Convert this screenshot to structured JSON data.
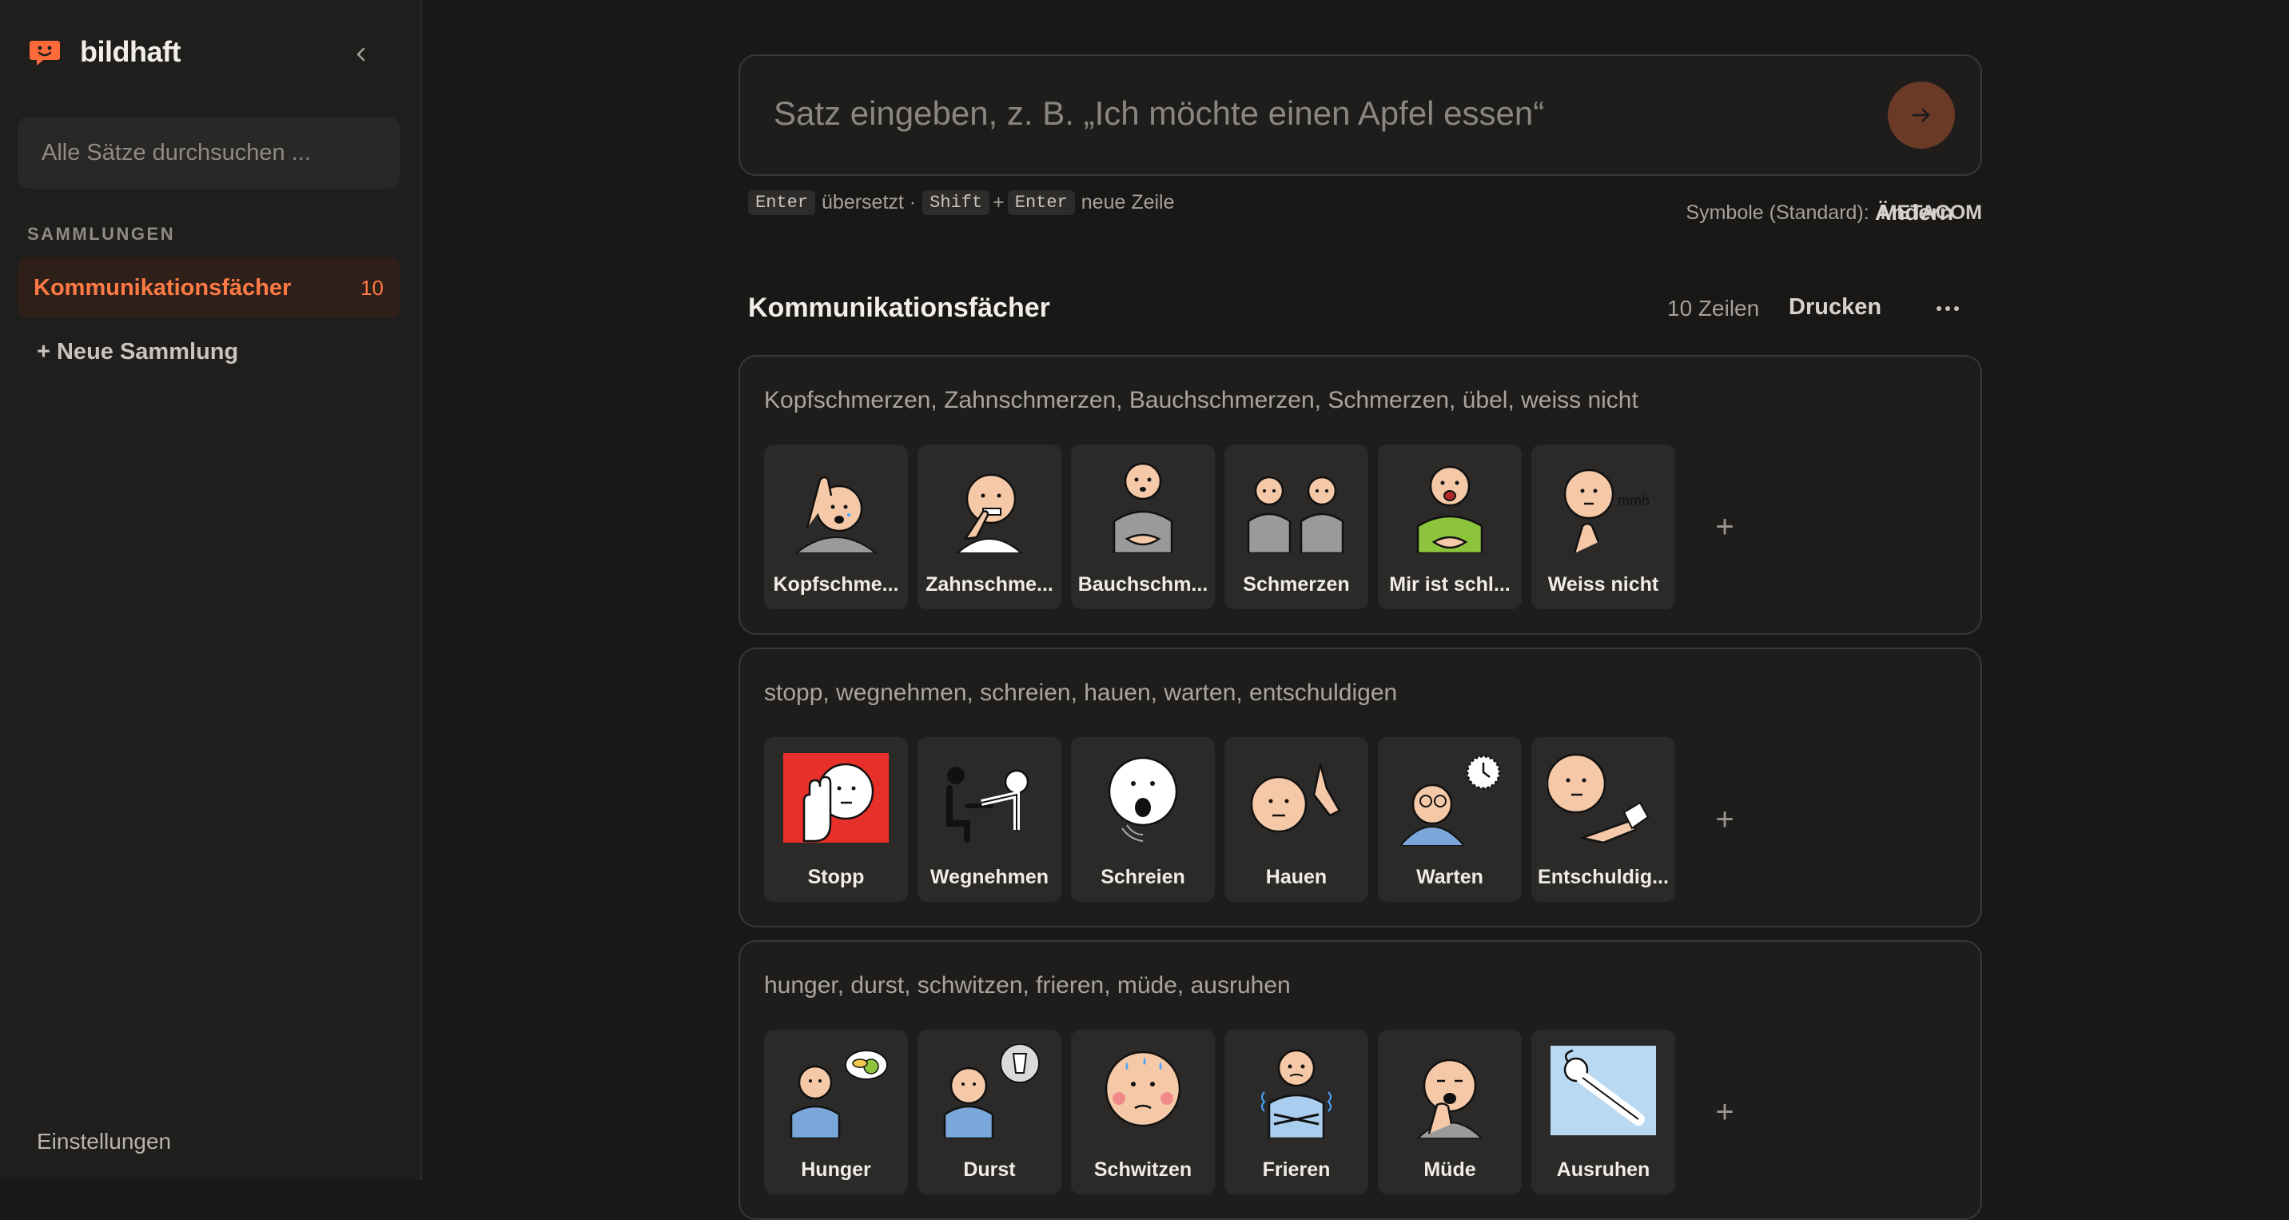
{
  "sidebar": {
    "app_name": "bildhaft",
    "search_placeholder": "Alle Sätze durchsuchen ...",
    "section_label": "SAMMLUNGEN",
    "collections": [
      {
        "name": "Kommunikationsfächer",
        "count": "10"
      }
    ],
    "new_collection_label": "+ Neue Sammlung",
    "settings_label": "Einstellungen"
  },
  "composer": {
    "placeholder": "Satz eingeben, z. B. „Ich möchte einen Apfel essen“",
    "hint_enter_key": "Enter",
    "hint_translate": "übersetzt ·",
    "hint_shift_key": "Shift",
    "hint_plus": "+",
    "hint_enter_key2": "Enter",
    "hint_newline": "neue Zeile",
    "symbols_label": "Symbole (Standard):",
    "symbols_value": "METACOM",
    "change_label": "Ändern"
  },
  "list": {
    "title": "Kommunikationsfächer",
    "row_count": "10 Zeilen",
    "print_label": "Drucken",
    "rows": [
      {
        "sentence": "Kopfschmerzen, Zahnschmerzen, Bauchschmerzen, Schmerzen, übel, weiss nicht",
        "symbols": [
          {
            "label": "Kopfschme...",
            "icon": "headache-icon"
          },
          {
            "label": "Zahnschme...",
            "icon": "toothache-icon"
          },
          {
            "label": "Bauchschm...",
            "icon": "stomachache-icon"
          },
          {
            "label": "Schmerzen",
            "icon": "pain-icon"
          },
          {
            "label": "Mir ist schl...",
            "icon": "nausea-icon"
          },
          {
            "label": "Weiss nicht",
            "icon": "dont-know-icon"
          }
        ]
      },
      {
        "sentence": "stopp, wegnehmen, schreien, hauen, warten, entschuldigen",
        "symbols": [
          {
            "label": "Stopp",
            "icon": "stop-icon"
          },
          {
            "label": "Wegnehmen",
            "icon": "take-away-icon"
          },
          {
            "label": "Schreien",
            "icon": "scream-icon"
          },
          {
            "label": "Hauen",
            "icon": "hit-icon"
          },
          {
            "label": "Warten",
            "icon": "wait-icon"
          },
          {
            "label": "Entschuldig...",
            "icon": "apologize-icon"
          }
        ]
      },
      {
        "sentence": "hunger, durst, schwitzen, frieren, müde, ausruhen",
        "symbols": [
          {
            "label": "Hunger",
            "icon": "hunger-icon"
          },
          {
            "label": "Durst",
            "icon": "thirst-icon"
          },
          {
            "label": "Schwitzen",
            "icon": "sweat-icon"
          },
          {
            "label": "Frieren",
            "icon": "freeze-icon"
          },
          {
            "label": "Müde",
            "icon": "tired-icon"
          },
          {
            "label": "Ausruhen",
            "icon": "rest-icon"
          }
        ]
      }
    ],
    "add_symbol_label": "+"
  },
  "colors": {
    "accent": "#ff7a45",
    "background": "#191817",
    "sidebar": "#1f1e1d",
    "tile": "#2b2a29"
  }
}
